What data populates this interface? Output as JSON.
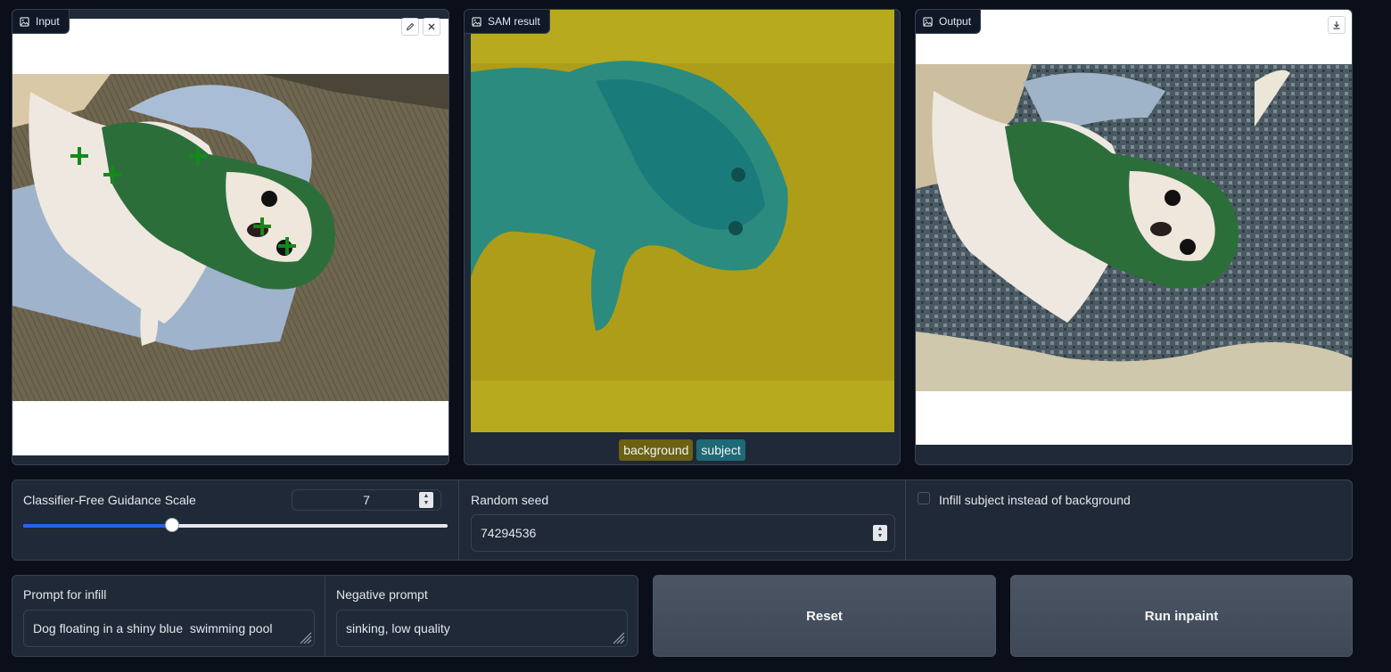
{
  "panels": {
    "input": {
      "title": "Input"
    },
    "sam": {
      "title": "SAM result",
      "legend": [
        {
          "label": "background",
          "color": "#6b6113"
        },
        {
          "label": "subject",
          "color": "#1d6a76"
        }
      ]
    },
    "output": {
      "title": "Output"
    }
  },
  "controls": {
    "cfg": {
      "label": "Classifier-Free Guidance Scale",
      "value": "7",
      "slider_fraction": 0.35
    },
    "seed": {
      "label": "Random seed",
      "value": "74294536"
    },
    "infill_subject": {
      "label": "Infill subject instead of background",
      "checked": false
    }
  },
  "prompts": {
    "infill": {
      "label": "Prompt for infill",
      "value": "Dog floating in a shiny blue  swimming pool"
    },
    "negative": {
      "label": "Negative prompt",
      "value": "sinking, low quality"
    }
  },
  "buttons": {
    "reset": "Reset",
    "run": "Run inpaint"
  },
  "colors": {
    "accent": "#2563eb",
    "point_marker": "#138a1a",
    "sam_background": "#b8aa1e",
    "sam_subject": "#1d8a8a"
  },
  "icons": [
    "image-icon",
    "edit-icon",
    "close-icon",
    "download-icon"
  ]
}
